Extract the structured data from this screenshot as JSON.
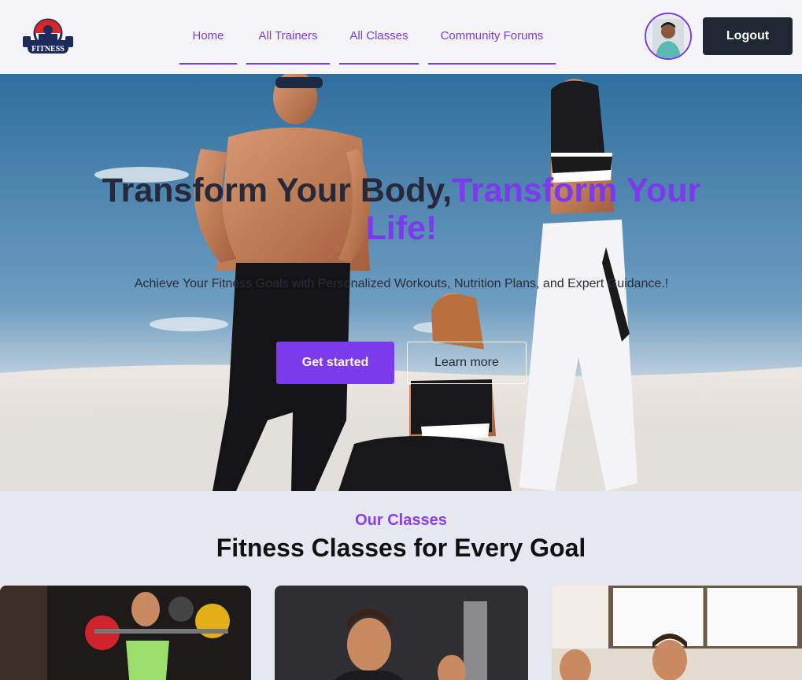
{
  "header": {
    "logo_text": "FITNESS",
    "nav": [
      {
        "label": "Home"
      },
      {
        "label": "All Trainers"
      },
      {
        "label": "All Classes"
      },
      {
        "label": "Community Forums"
      }
    ],
    "logout_label": "Logout"
  },
  "hero": {
    "title_part1": "Transform Your Body,",
    "title_part2": "Transform Your Life!",
    "subtitle": "Achieve Your Fitness Goals with Personalized Workouts, Nutrition Plans, and Expert Guidance.!",
    "primary_button": "Get started",
    "secondary_button": "Learn more"
  },
  "classes": {
    "eyebrow": "Our Classes",
    "title": "Fitness Classes for Every Goal"
  },
  "colors": {
    "accent": "#7c3aed",
    "dark": "#1f2733",
    "section_bg": "#e5e8f0"
  }
}
